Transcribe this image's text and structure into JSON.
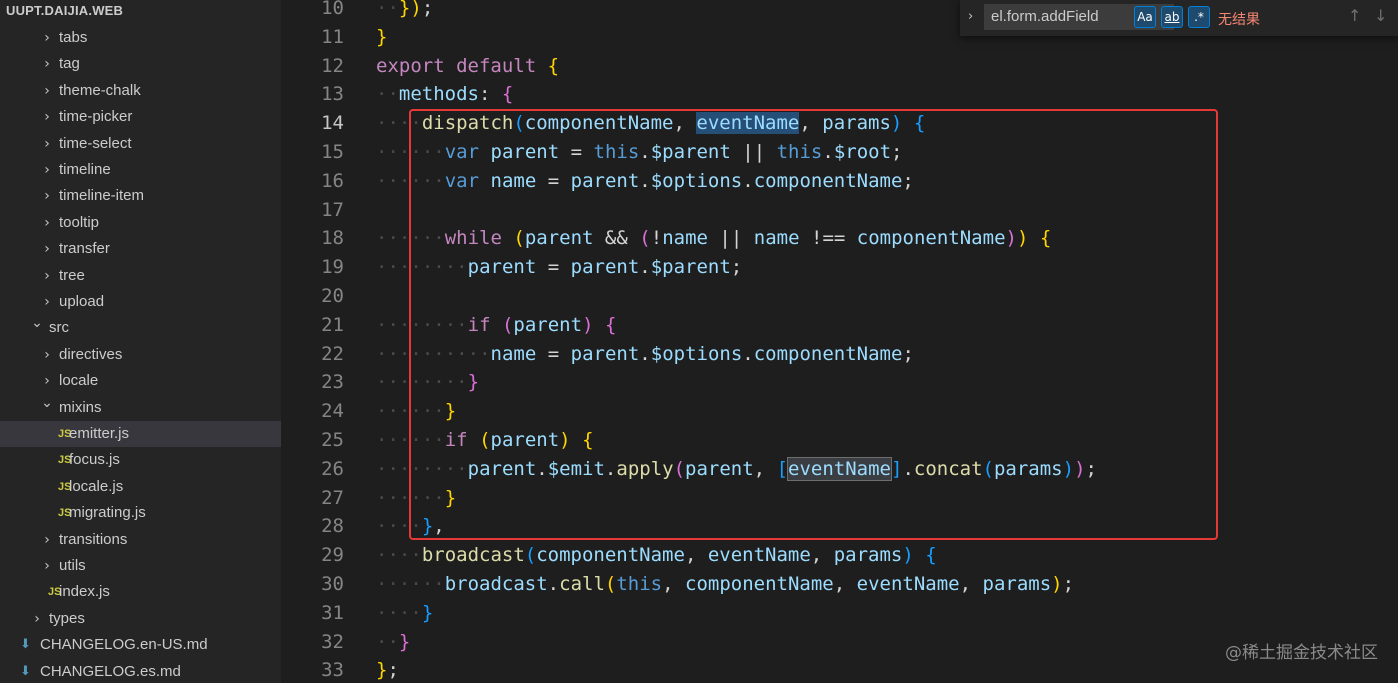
{
  "explorer": {
    "root": "UUPT.DAIJIA.WEB",
    "items": [
      {
        "label": "tabs",
        "kind": "folder-closed"
      },
      {
        "label": "tag",
        "kind": "folder-closed"
      },
      {
        "label": "theme-chalk",
        "kind": "folder-closed"
      },
      {
        "label": "time-picker",
        "kind": "folder-closed"
      },
      {
        "label": "time-select",
        "kind": "folder-closed"
      },
      {
        "label": "timeline",
        "kind": "folder-closed"
      },
      {
        "label": "timeline-item",
        "kind": "folder-closed"
      },
      {
        "label": "tooltip",
        "kind": "folder-closed"
      },
      {
        "label": "transfer",
        "kind": "folder-closed"
      },
      {
        "label": "tree",
        "kind": "folder-closed"
      },
      {
        "label": "upload",
        "kind": "folder-closed"
      },
      {
        "label": "src",
        "kind": "folder-open"
      },
      {
        "label": "directives",
        "kind": "folder-closed"
      },
      {
        "label": "locale",
        "kind": "folder-closed"
      },
      {
        "label": "mixins",
        "kind": "folder-open"
      },
      {
        "label": "emitter.js",
        "kind": "js",
        "selected": true
      },
      {
        "label": "focus.js",
        "kind": "js"
      },
      {
        "label": "locale.js",
        "kind": "js"
      },
      {
        "label": "migrating.js",
        "kind": "js"
      },
      {
        "label": "transitions",
        "kind": "folder-closed"
      },
      {
        "label": "utils",
        "kind": "folder-closed"
      },
      {
        "label": "index.js",
        "kind": "js"
      },
      {
        "label": "types",
        "kind": "folder-closed"
      },
      {
        "label": "CHANGELOG.en-US.md",
        "kind": "md"
      },
      {
        "label": "CHANGELOG.es.md",
        "kind": "md"
      }
    ],
    "icons": {
      "js_badge": "JS",
      "chevron_right": "chevron-right-icon",
      "chevron_down": "chevron-down-icon",
      "md_icon": "markdown-download-icon"
    }
  },
  "find_widget": {
    "query": "el.form.addField",
    "match_case": "Aa",
    "whole_word": "ab",
    "regex": ".*",
    "result": "无结果"
  },
  "editor": {
    "active_line": 14,
    "line_numbers": [
      "10",
      "11",
      "12",
      "13",
      "14",
      "15",
      "16",
      "17",
      "18",
      "19",
      "20",
      "21",
      "22",
      "23",
      "24",
      "25",
      "26",
      "27",
      "28",
      "29",
      "30",
      "31",
      "32",
      "33"
    ],
    "lines": [
      "  });",
      "}",
      "export default {",
      "  methods: {",
      "    dispatch(componentName, eventName, params) {",
      "      var parent = this.$parent || this.$root;",
      "      var name = parent.$options.componentName;",
      "",
      "      while (parent && (!name || name !== componentName)) {",
      "        parent = parent.$parent;",
      "",
      "        if (parent) {",
      "          name = parent.$options.componentName;",
      "        }",
      "      }",
      "      if (parent) {",
      "        parent.$emit.apply(parent, [eventName].concat(params));",
      "      }",
      "    },",
      "    broadcast(componentName, eventName, params) {",
      "      broadcast.call(this, componentName, eventName, params);",
      "    }",
      "  }",
      "};"
    ]
  },
  "watermark": "@稀土掘金技术社区",
  "colors": {
    "highlight_box": "#e53935",
    "keyword": "#c586c0",
    "storage": "#569cd6",
    "function": "#dcdcaa",
    "variable": "#9cdcfe"
  }
}
